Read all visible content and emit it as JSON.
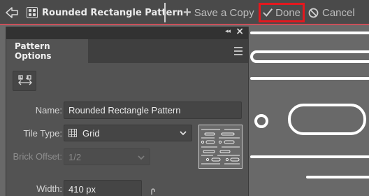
{
  "topbar": {
    "pattern_name": "Rounded Rectangle Pattern",
    "save_copy_label": "Save a Copy",
    "done_label": "Done",
    "cancel_label": "Cancel",
    "accent_color": "#c9505a",
    "highlight_color": "#e4181e"
  },
  "panel": {
    "tab_label": "Pattern Options",
    "name_label": "Name:",
    "name_value": "Rounded Rectangle Pattern",
    "tile_type_label": "Tile Type:",
    "tile_type_value": "Grid",
    "brick_offset_label": "Brick Offset:",
    "brick_offset_value": "1/2",
    "width_label": "Width:",
    "width_value": "410 px"
  },
  "icons": [
    "back-arrow-icon",
    "pattern-swatch-icon",
    "plus-icon",
    "checkmark-icon",
    "ban-icon",
    "collapse-icon",
    "close-icon",
    "menu-icon",
    "pattern-tile-tool-icon",
    "grid-icon",
    "chevron-down-icon",
    "link-icon"
  ]
}
